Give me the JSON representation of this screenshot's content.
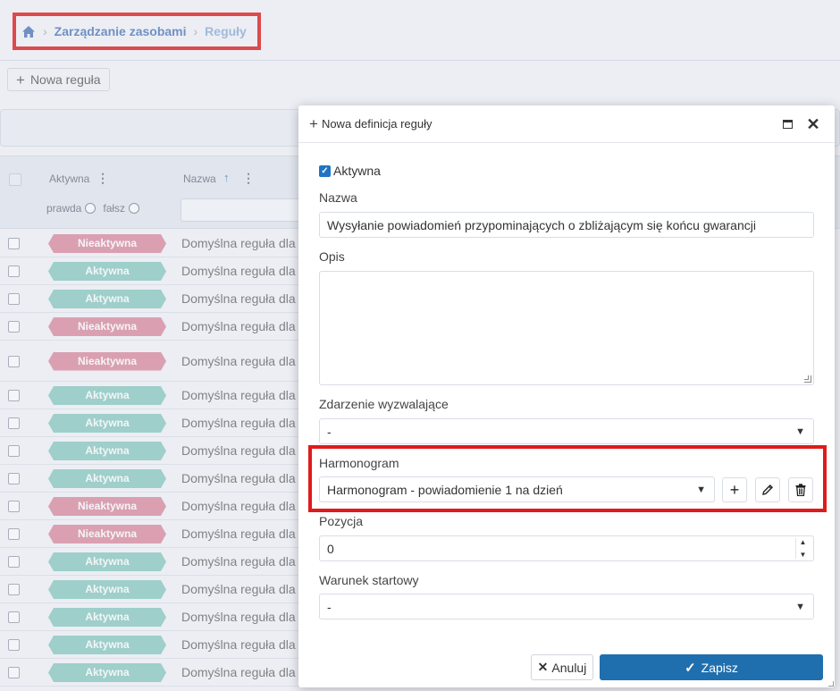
{
  "breadcrumb": {
    "home_icon": "home-icon",
    "section": "Zarządzanie zasobami",
    "current": "Reguły"
  },
  "toolbar": {
    "new_rule_label": "Nowa reguła"
  },
  "grid": {
    "headers": {
      "active": "Aktywna",
      "name": "Nazwa",
      "true_label": "prawda",
      "false_label": "fałsz"
    },
    "rows": [
      {
        "status": "Nieaktywna",
        "on": false,
        "name": "Domyślna reguła dla"
      },
      {
        "status": "Aktywna",
        "on": true,
        "name": "Domyślna reguła dla"
      },
      {
        "status": "Aktywna",
        "on": true,
        "name": "Domyślna reguła dla"
      },
      {
        "status": "Nieaktywna",
        "on": false,
        "name": "Domyślna reguła dla"
      },
      {
        "status": "Nieaktywna",
        "on": false,
        "name": "Domyślna reguła dla"
      },
      {
        "status": "Aktywna",
        "on": true,
        "name": "Domyślna reguła dla"
      },
      {
        "status": "Aktywna",
        "on": true,
        "name": "Domyślna reguła dla"
      },
      {
        "status": "Aktywna",
        "on": true,
        "name": "Domyślna reguła dla"
      },
      {
        "status": "Aktywna",
        "on": true,
        "name": "Domyślna reguła dla"
      },
      {
        "status": "Nieaktywna",
        "on": false,
        "name": "Domyślna reguła dla"
      },
      {
        "status": "Nieaktywna",
        "on": false,
        "name": "Domyślna reguła dla"
      },
      {
        "status": "Aktywna",
        "on": true,
        "name": "Domyślna reguła dla"
      },
      {
        "status": "Aktywna",
        "on": true,
        "name": "Domyślna reguła dla"
      },
      {
        "status": "Aktywna",
        "on": true,
        "name": "Domyślna reguła dla"
      },
      {
        "status": "Aktywna",
        "on": true,
        "name": "Domyślna reguła dla"
      },
      {
        "status": "Aktywna",
        "on": true,
        "name": "Domyślna reguła dla"
      }
    ]
  },
  "modal": {
    "title": "Nowa definicja reguły",
    "active_label": "Aktywna",
    "active_checked": true,
    "name_label": "Nazwa",
    "name_value": "Wysyłanie powiadomień przypominających o zbliżającym się końcu gwarancji",
    "description_label": "Opis",
    "description_value": "",
    "trigger_label": "Zdarzenie wyzwalające",
    "trigger_value": "-",
    "schedule_label": "Harmonogram",
    "schedule_value": "Harmonogram - powiadomienie 1 na dzień",
    "position_label": "Pozycja",
    "position_value": "0",
    "start_condition_label": "Warunek startowy",
    "start_condition_value": "-",
    "cancel_label": "Anuluj",
    "save_label": "Zapisz"
  },
  "colors": {
    "active_badge": "#8ccdc2",
    "inactive_badge": "#dd8ea1",
    "primary": "#1f6fae",
    "highlight": "#e01b1b"
  }
}
